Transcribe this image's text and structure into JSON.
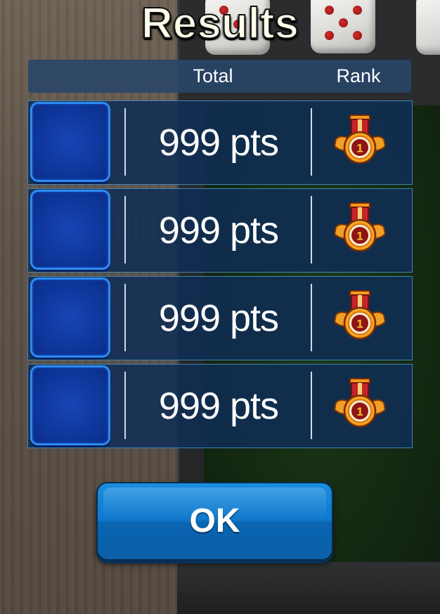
{
  "screen": {
    "title": "Results"
  },
  "table_header": {
    "total_label": "Total",
    "rank_label": "Rank"
  },
  "rows": [
    {
      "points": "999 pts",
      "rank": "1",
      "rank_icon": "gold-medal-icon"
    },
    {
      "points": "999 pts",
      "rank": "1",
      "rank_icon": "gold-medal-icon"
    },
    {
      "points": "999 pts",
      "rank": "1",
      "rank_icon": "gold-medal-icon"
    },
    {
      "points": "999 pts",
      "rank": "1",
      "rank_icon": "gold-medal-icon"
    }
  ],
  "actions": {
    "ok_label": "OK"
  },
  "colors": {
    "panel": "#0f2d55",
    "row_border": "#3f86b4",
    "avatar_border": "#2f8af2",
    "button": "#0f78cc",
    "title_text": "#fffcea"
  }
}
